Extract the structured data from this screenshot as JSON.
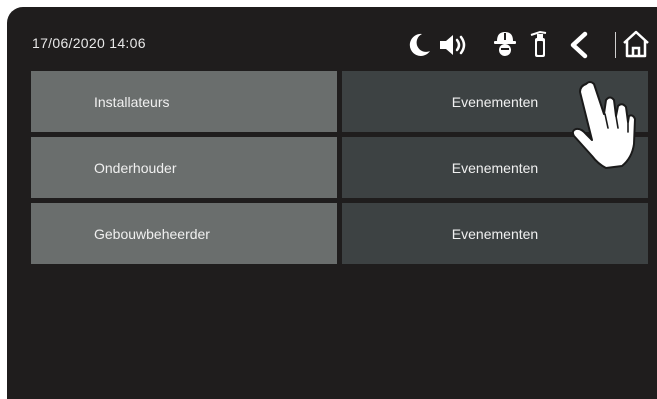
{
  "status_bar": {
    "datetime": "17/06/2020  14:06",
    "icons": [
      "moon-icon",
      "speaker-icon",
      "helmet-icon",
      "fire-extinguisher-icon",
      "back-icon",
      "home-icon"
    ]
  },
  "menu": {
    "rows": [
      {
        "label": "Installateurs",
        "action": "Evenementen"
      },
      {
        "label": "Onderhouder",
        "action": "Evenementen"
      },
      {
        "label": "Gebouwbeheerder",
        "action": "Evenementen"
      }
    ]
  },
  "colors": {
    "background": "#1f1d1d",
    "left_cell": "#6a6e6d",
    "right_cell": "#3d4243",
    "text": "#f0f0f0"
  }
}
